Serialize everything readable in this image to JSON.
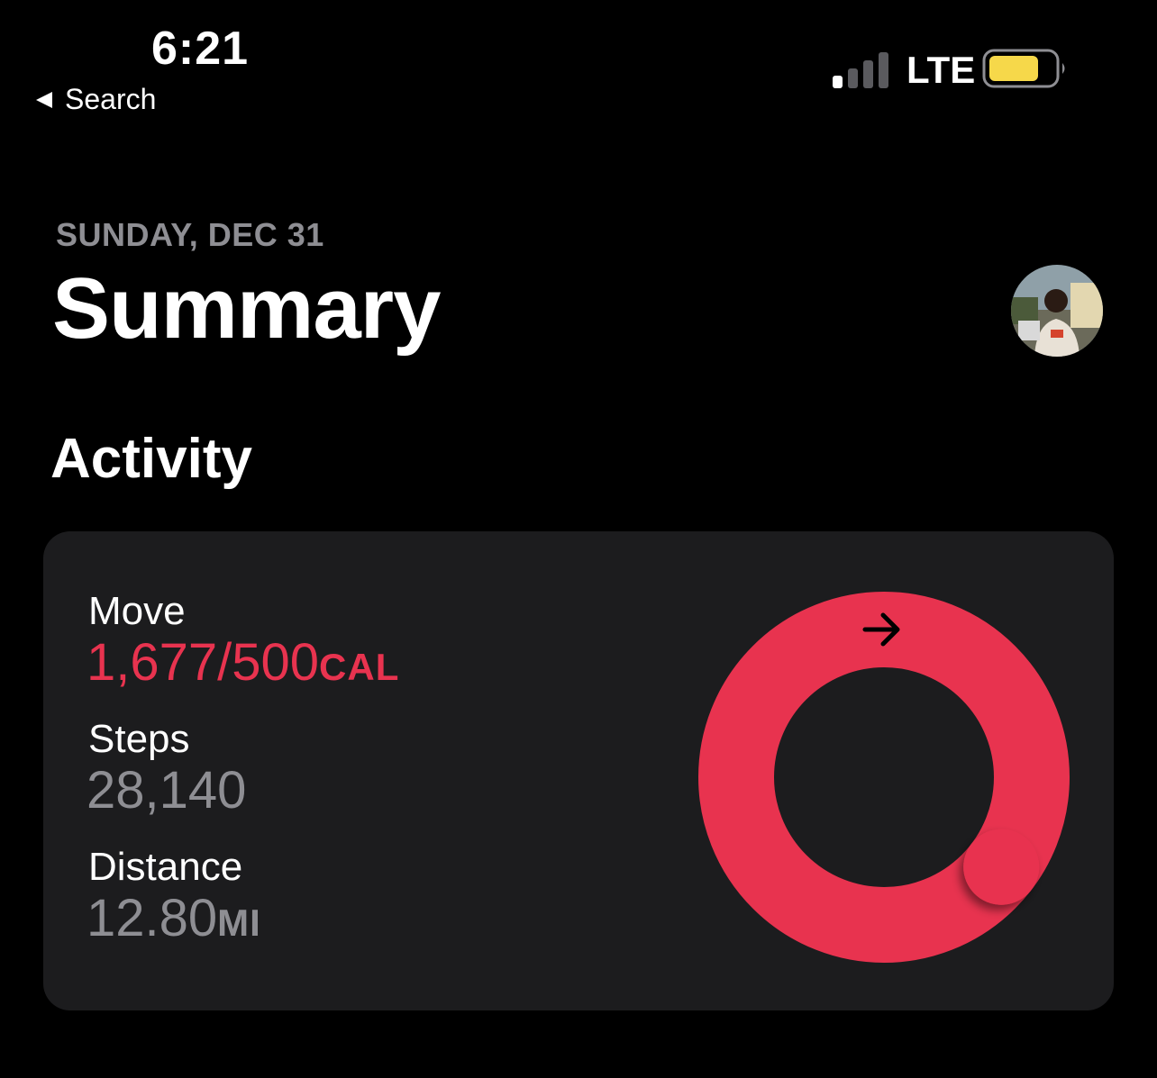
{
  "status_bar": {
    "time": "6:21",
    "back_label": "Search",
    "network": "LTE",
    "signal_bars_active": 1,
    "signal_bars_total": 4,
    "battery_level": 0.75,
    "battery_color": "#f6d84a"
  },
  "header": {
    "date": "SUNDAY, DEC 31",
    "title": "Summary",
    "avatar_icon": "profile-avatar"
  },
  "activity": {
    "section_title": "Activity",
    "move": {
      "label": "Move",
      "value": "1,677/500",
      "unit": "CAL",
      "current": 1677,
      "goal": 500,
      "color": "#e8334f"
    },
    "steps": {
      "label": "Steps",
      "value": "28,140"
    },
    "distance": {
      "label": "Distance",
      "value": "12.80",
      "unit": "MI"
    },
    "ring_icon": "arrow-right-icon"
  }
}
